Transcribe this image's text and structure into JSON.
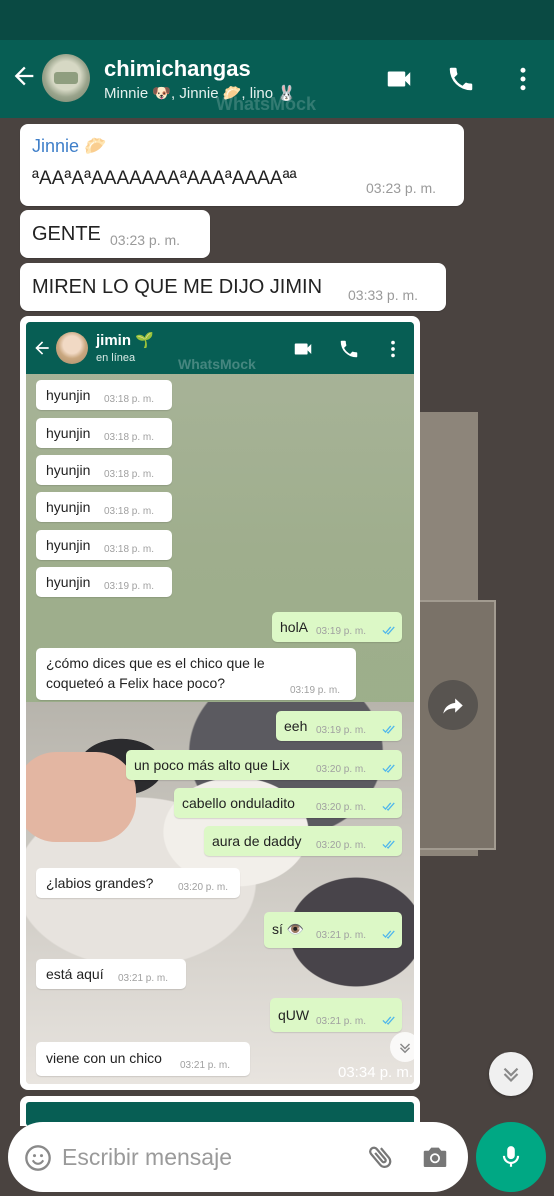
{
  "header": {
    "title": "chimichangas",
    "subtitle": "Minnie 🐶, Jinnie 🥟, lino 🐰",
    "watermark": "WhatsMock"
  },
  "messages": [
    {
      "sender": "Jinnie 🥟",
      "text": "ªAAªAªAAAAAAAªAAAªAAAAªª",
      "time": "03:23 p. m."
    },
    {
      "text": "GENTE",
      "time": "03:23 p. m."
    },
    {
      "text": "MIREN LO QUE ME DIJO JIMIN",
      "time": "03:33 p. m."
    }
  ],
  "screenshot": {
    "contact_name": "jimin 🌱",
    "contact_status": "en línea",
    "watermark": "WhatsMock",
    "time": "03:34 p. m.",
    "bubbles": [
      {
        "dir": "in",
        "text": "hyunjin",
        "time": "03:18 p. m."
      },
      {
        "dir": "in",
        "text": "hyunjin",
        "time": "03:18 p. m."
      },
      {
        "dir": "in",
        "text": "hyunjin",
        "time": "03:18 p. m."
      },
      {
        "dir": "in",
        "text": "hyunjin",
        "time": "03:18 p. m."
      },
      {
        "dir": "in",
        "text": "hyunjin",
        "time": "03:18 p. m."
      },
      {
        "dir": "in",
        "text": "hyunjin",
        "time": "03:19 p. m."
      },
      {
        "dir": "out",
        "text": "holA",
        "time": "03:19 p. m."
      },
      {
        "dir": "in",
        "text": "¿cómo dices que es el chico que le",
        "text2": "coqueteó a Felix hace poco?",
        "time": "03:19 p. m."
      },
      {
        "dir": "out",
        "text": "eeh",
        "time": "03:19 p. m."
      },
      {
        "dir": "out",
        "text": "un poco más alto que Lix",
        "time": "03:20 p. m."
      },
      {
        "dir": "out",
        "text": "cabello onduladito",
        "time": "03:20 p. m."
      },
      {
        "dir": "out",
        "text": "aura de daddy",
        "time": "03:20 p. m."
      },
      {
        "dir": "in",
        "text": "¿labios grandes?",
        "time": "03:20 p. m."
      },
      {
        "dir": "out",
        "text": "sí 👁️",
        "time": "03:21 p. m."
      },
      {
        "dir": "in",
        "text": "está aquí",
        "time": "03:21 p. m."
      },
      {
        "dir": "out",
        "text": "qUW",
        "time": "03:21 p. m."
      },
      {
        "dir": "in",
        "text": "viene con un chico",
        "time": "03:21 p. m."
      }
    ]
  },
  "input": {
    "placeholder": "Escribir mensaje"
  },
  "icons": [
    "back-arrow-icon",
    "video-call-icon",
    "phone-icon",
    "more-vert-icon",
    "emoji-icon",
    "attach-icon",
    "camera-icon",
    "mic-icon",
    "forward-icon",
    "scroll-down-icon",
    "double-check-icon"
  ],
  "colors": {
    "header": "#075e54",
    "outgoing_bubble": "#dcf8c6",
    "mic_button": "#00a884",
    "sender_name": "#3f7fc9"
  }
}
